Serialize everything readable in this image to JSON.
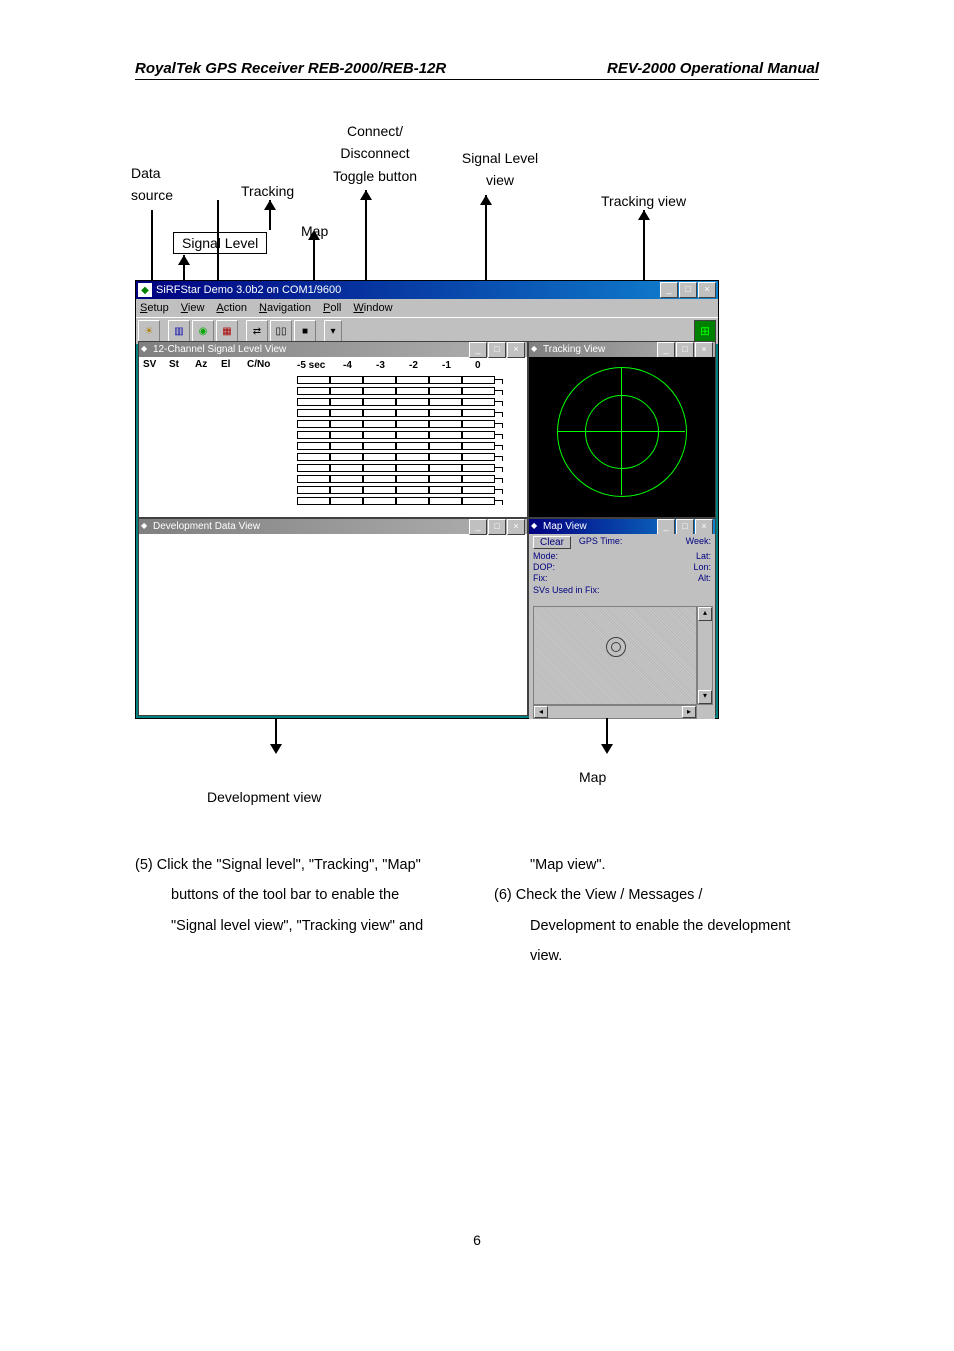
{
  "header": {
    "left": "RoyalTek GPS Receiver REB-2000/REB-12R",
    "right": "REV-2000 Operational Manual"
  },
  "callouts": {
    "data_source": "Data source",
    "signal_level": "Signal Level",
    "tracking": "Tracking",
    "map": "Map",
    "connect": "Connect/ Disconnect Toggle button",
    "signal_level_view": "Signal Level view",
    "tracking_view": "Tracking view",
    "development_view": "Development view",
    "map_label": "Map"
  },
  "app": {
    "title": "SiRFStar Demo 3.0b2 on COM1/9600",
    "menu": [
      "Setup",
      "View",
      "Action",
      "Navigation",
      "Poll",
      "Window"
    ],
    "signal_win_title": "12-Channel Signal Level View",
    "signal_headers": [
      "SV",
      "St",
      "Az",
      "El",
      "C/No"
    ],
    "signal_scale": [
      "-5 sec",
      "-4",
      "-3",
      "-2",
      "-1",
      "0"
    ],
    "tracking_win_title": "Tracking View",
    "dev_win_title": "Development Data View",
    "map_win_title": "Map View",
    "map_clear": "Clear",
    "map_left_labels": [
      "Mode:",
      "DOP:",
      "Fix:"
    ],
    "map_center_top": "GPS Time:",
    "map_right_top": "Week:",
    "map_right_labels": [
      "Lat:",
      "Lon:",
      "Alt:"
    ],
    "map_svs": "SVs Used in Fix:"
  },
  "body": {
    "item5_l1": "(5)  Click the \"Signal level\", \"Tracking\", \"Map\"",
    "item5_l2": "buttons of the tool bar to enable the",
    "item5_l3": "\"Signal level view\", \"Tracking view\" and",
    "col2_top": "\"Map view\".",
    "item6_l1": "(6)  Check the View / Messages /",
    "item6_l2": "Development to enable the development",
    "item6_l3": "view."
  },
  "page_number": "6"
}
